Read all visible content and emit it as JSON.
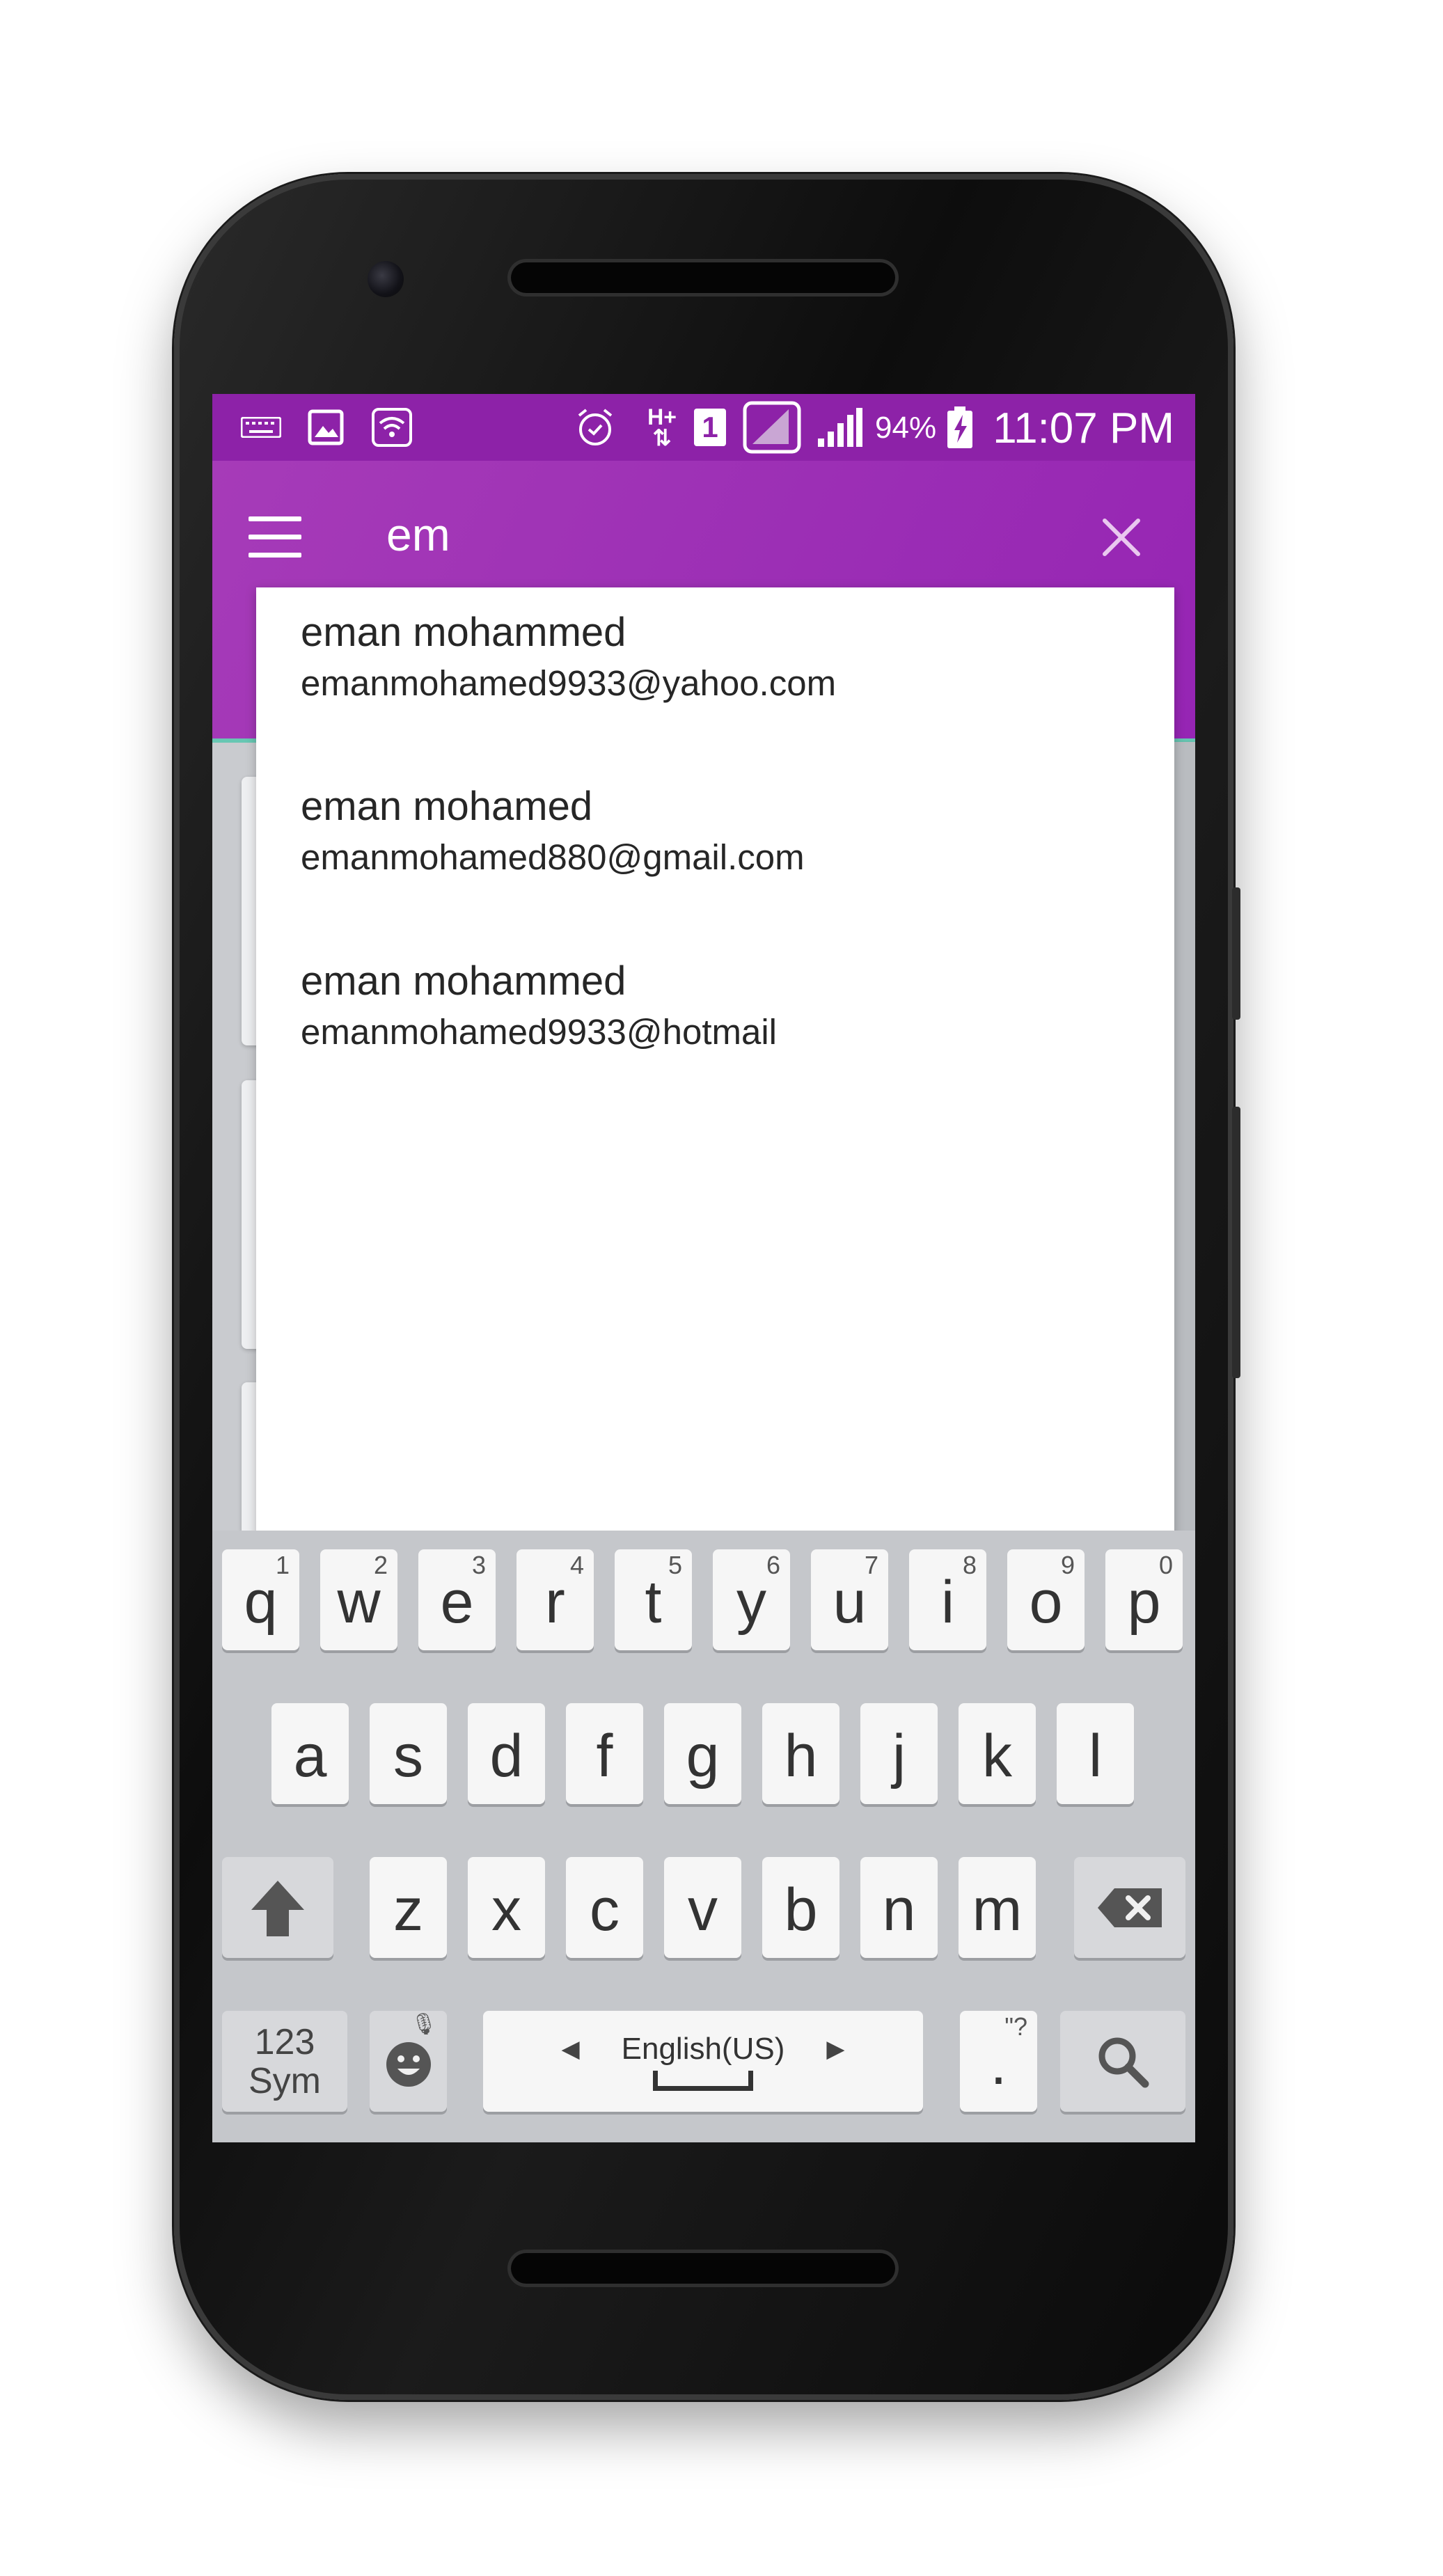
{
  "status_bar": {
    "battery_percent": "94%",
    "time": "11:07 PM",
    "sim_slot": "1",
    "network_type": "H+",
    "icons": [
      "keyboard-icon",
      "image-icon",
      "wifi-hotspot-icon",
      "alarm-icon",
      "data-arrows-icon",
      "sim-icon",
      "no-signal-icon",
      "signal-icon",
      "battery-charging-icon"
    ]
  },
  "search": {
    "query": "em"
  },
  "suggestions": [
    {
      "name": "eman mohammed",
      "email": "emanmohamed9933@yahoo.com"
    },
    {
      "name": "eman mohamed",
      "email": "emanmohamed880@gmail.com"
    },
    {
      "name": "eman mohammed",
      "email": "emanmohamed9933@hotmail"
    }
  ],
  "keyboard": {
    "row1": [
      {
        "key": "q",
        "hint": "1"
      },
      {
        "key": "w",
        "hint": "2"
      },
      {
        "key": "e",
        "hint": "3"
      },
      {
        "key": "r",
        "hint": "4"
      },
      {
        "key": "t",
        "hint": "5"
      },
      {
        "key": "y",
        "hint": "6"
      },
      {
        "key": "u",
        "hint": "7"
      },
      {
        "key": "i",
        "hint": "8"
      },
      {
        "key": "o",
        "hint": "9"
      },
      {
        "key": "p",
        "hint": "0"
      }
    ],
    "row2": [
      "a",
      "s",
      "d",
      "f",
      "g",
      "h",
      "j",
      "k",
      "l"
    ],
    "row3": [
      "z",
      "x",
      "c",
      "v",
      "b",
      "n",
      "m"
    ],
    "sym_top": "123",
    "sym_bottom": "Sym",
    "space_label": "English(US)",
    "period": ".",
    "period_hint": "\"?"
  },
  "colors": {
    "status_bar": "#8d22a8",
    "app_bar": "#9c2fb5",
    "accent_teal": "#67c7b3",
    "keyboard_bg": "#c5c7cb"
  }
}
